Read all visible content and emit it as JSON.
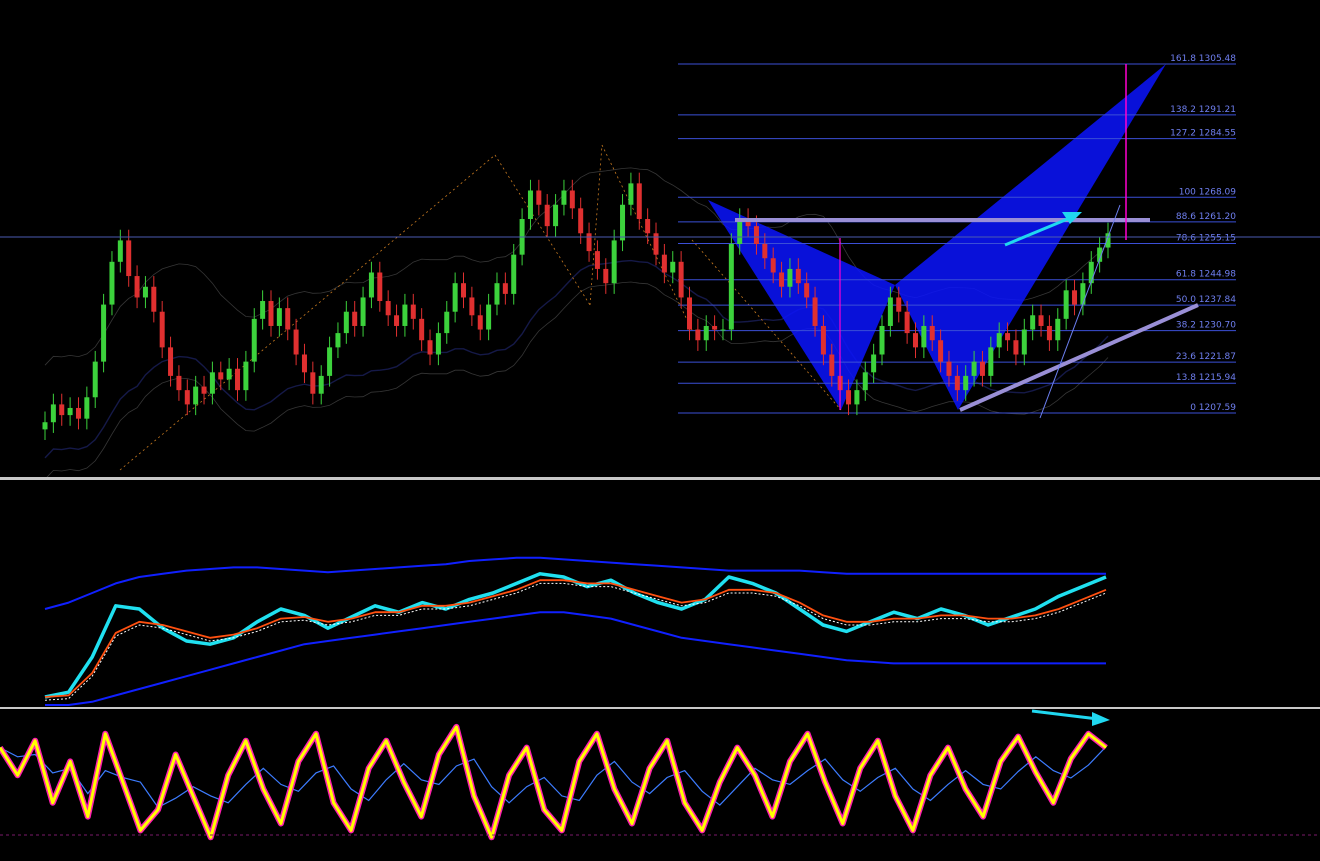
{
  "colors": {
    "background": "#000000",
    "bull_candle": "#3cd23c",
    "bear_candle": "#e03030",
    "fib_line": "#3b4fd6",
    "fib_label": "#6f7ff0",
    "pattern_fill": "#0a14ff",
    "resistance": "#9a8fd6",
    "arrow": "#20d8f0",
    "magenta": "#ff00d0",
    "osc_cyan": "#20e0f0",
    "osc_orange": "#ff5010",
    "band_blue": "#1020ff",
    "stoch_yellow": "#ffff00",
    "stoch_pink": "#ff20b0",
    "separator": "#c8c8c8"
  },
  "chart_data": [
    {
      "type": "candlestick",
      "title": "",
      "grid": false,
      "ylim": [
        1195,
        1310
      ],
      "fibonacci_levels": [
        {
          "ratio": "0",
          "price": "1207.59",
          "label": "0 1207.59"
        },
        {
          "ratio": "13.8",
          "price": "1215.94",
          "label": "13.8 1215.94"
        },
        {
          "ratio": "23.6",
          "price": "1221.87",
          "label": "23.6 1221.87"
        },
        {
          "ratio": "38.2",
          "price": "1230.70",
          "label": "38.2 1230.70"
        },
        {
          "ratio": "50.0",
          "price": "1237.84",
          "label": "50.0 1237.84"
        },
        {
          "ratio": "61.8",
          "price": "1244.98",
          "label": "61.8 1244.98"
        },
        {
          "ratio": "78.6",
          "price": "1255.15",
          "label": "78.6 1255.15"
        },
        {
          "ratio": "88.6",
          "price": "1261.20",
          "label": "88.6 1261.20"
        },
        {
          "ratio": "100",
          "price": "1268.09",
          "label": "100 1268.09"
        },
        {
          "ratio": "127.2",
          "price": "1284.55",
          "label": "127.2 1284.55"
        },
        {
          "ratio": "138.2",
          "price": "1291.21",
          "label": "138.2 1291.21"
        },
        {
          "ratio": "161.8",
          "price": "1305.48",
          "label": "161.8 1305.48"
        }
      ],
      "closes": [
        1205,
        1210,
        1207,
        1209,
        1206,
        1212,
        1222,
        1238,
        1250,
        1256,
        1246,
        1240,
        1243,
        1236,
        1226,
        1218,
        1214,
        1210,
        1215,
        1213,
        1219,
        1217,
        1220,
        1214,
        1222,
        1234,
        1239,
        1232,
        1237,
        1231,
        1224,
        1219,
        1213,
        1218,
        1226,
        1230,
        1236,
        1232,
        1240,
        1247,
        1239,
        1235,
        1232,
        1238,
        1234,
        1228,
        1224,
        1230,
        1236,
        1244,
        1240,
        1235,
        1231,
        1238,
        1244,
        1241,
        1252,
        1262,
        1270,
        1266,
        1260,
        1266,
        1270,
        1265,
        1258,
        1253,
        1248,
        1244,
        1256,
        1266,
        1272,
        1262,
        1258,
        1252,
        1247,
        1250,
        1240,
        1231,
        1228,
        1232,
        1231,
        1231,
        1255,
        1262,
        1260,
        1255,
        1251,
        1247,
        1243,
        1248,
        1244,
        1240,
        1232,
        1224,
        1218,
        1214,
        1210,
        1214,
        1219,
        1224,
        1232,
        1240,
        1236,
        1230,
        1226,
        1232,
        1228,
        1222,
        1218,
        1214,
        1218,
        1222,
        1218,
        1226,
        1230,
        1228,
        1224,
        1231,
        1235,
        1232,
        1228,
        1234,
        1242,
        1238,
        1244,
        1250,
        1254,
        1258
      ]
    },
    {
      "type": "line",
      "title": "",
      "ylim": [
        0,
        100
      ],
      "series": [
        {
          "color": "#20e0f0",
          "values": [
            5,
            8,
            30,
            62,
            60,
            48,
            40,
            38,
            42,
            52,
            60,
            56,
            48,
            55,
            62,
            58,
            64,
            60,
            66,
            70,
            76,
            82,
            80,
            74,
            78,
            70,
            64,
            60,
            66,
            80,
            76,
            70,
            60,
            50,
            46,
            52,
            58,
            54,
            60,
            56,
            50,
            55,
            60,
            68,
            74,
            80
          ]
        },
        {
          "color": "#ff5010",
          "values": [
            5,
            6,
            20,
            45,
            52,
            50,
            46,
            42,
            44,
            48,
            54,
            55,
            52,
            54,
            58,
            58,
            62,
            62,
            64,
            68,
            72,
            78,
            78,
            76,
            76,
            72,
            68,
            64,
            66,
            72,
            72,
            70,
            64,
            56,
            52,
            52,
            54,
            54,
            56,
            56,
            54,
            54,
            56,
            60,
            66,
            72
          ]
        },
        {
          "color": "#1020ff",
          "values": [
            60,
            64,
            70,
            76,
            80,
            82,
            84,
            85,
            86,
            86,
            85,
            84,
            83,
            84,
            85,
            86,
            87,
            88,
            90,
            91,
            92,
            92,
            91,
            90,
            89,
            88,
            87,
            86,
            85,
            84,
            84,
            84,
            84,
            83,
            82,
            82,
            82,
            82,
            82,
            82,
            82,
            82,
            82,
            82,
            82,
            82
          ]
        },
        {
          "color": "#1020ff",
          "values": [
            0,
            0,
            2,
            6,
            10,
            14,
            18,
            22,
            26,
            30,
            34,
            38,
            40,
            42,
            44,
            46,
            48,
            50,
            52,
            54,
            56,
            58,
            58,
            56,
            54,
            50,
            46,
            42,
            40,
            38,
            36,
            34,
            32,
            30,
            28,
            27,
            26,
            26,
            26,
            26,
            26,
            26,
            26,
            26,
            26,
            26
          ]
        }
      ]
    },
    {
      "type": "line",
      "title": "",
      "ylim": [
        0,
        100
      ],
      "series": [
        {
          "color": "#ffff00",
          "values": [
            80,
            60,
            85,
            40,
            70,
            30,
            90,
            55,
            20,
            35,
            75,
            45,
            15,
            60,
            85,
            50,
            25,
            70,
            90,
            40,
            20,
            65,
            85,
            55,
            30,
            75,
            95,
            45,
            15,
            60,
            80,
            35,
            20,
            70,
            90,
            50,
            25,
            65,
            85,
            40,
            20,
            55,
            80,
            60,
            30,
            70,
            90,
            55,
            25,
            65,
            85,
            45,
            20,
            60,
            80,
            50,
            30,
            70,
            88,
            62,
            40,
            72,
            90,
            80
          ]
        }
      ]
    }
  ]
}
